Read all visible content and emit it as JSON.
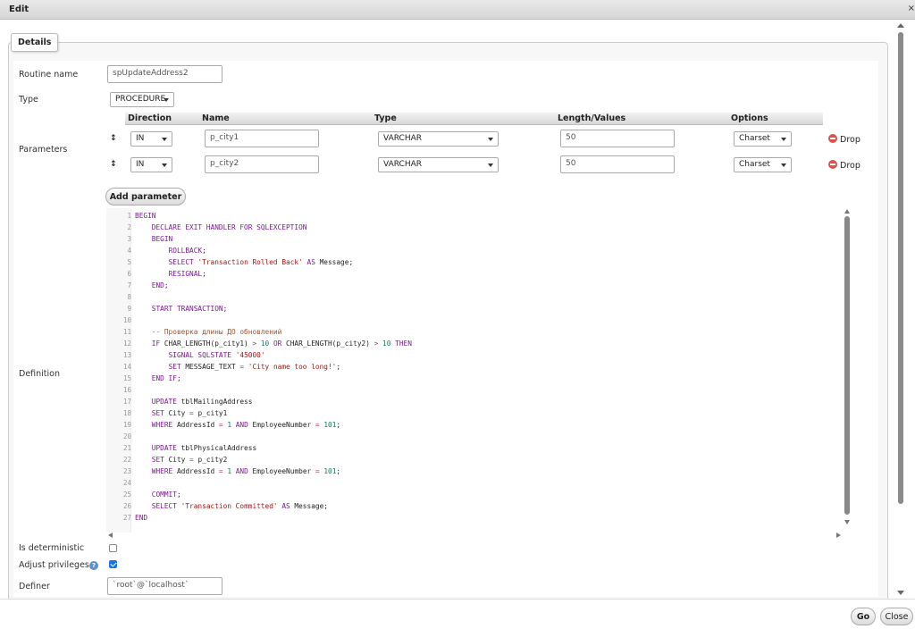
{
  "dialog": {
    "title": "Edit",
    "close_glyph": "×"
  },
  "tab": {
    "label": "Details"
  },
  "routine": {
    "label": "Routine name",
    "value": "spUpdateAddress2"
  },
  "type": {
    "label": "Type",
    "value": "PROCEDURE"
  },
  "parameters": {
    "label": "Parameters",
    "headers": {
      "direction": "Direction",
      "name": "Name",
      "type": "Type",
      "length": "Length/Values",
      "options": "Options"
    },
    "drag_glyph": "↕",
    "drop_label": "Drop",
    "rows": [
      {
        "direction": "IN",
        "name": "p_city1",
        "type": "VARCHAR",
        "length": "50",
        "options": "Charset"
      },
      {
        "direction": "IN",
        "name": "p_city2",
        "type": "VARCHAR",
        "length": "50",
        "options": "Charset"
      }
    ],
    "add_label": "Add parameter"
  },
  "definition": {
    "label": "Definition",
    "line_numbers": [
      "1",
      "2",
      "3",
      "4",
      "5",
      "6",
      "7",
      "8",
      "9",
      "10",
      "11",
      "12",
      "13",
      "14",
      "15",
      "16",
      "17",
      "18",
      "19",
      "20",
      "21",
      "22",
      "23",
      "24",
      "25",
      "26",
      "27"
    ]
  },
  "deterministic": {
    "label": "Is deterministic",
    "checked": false
  },
  "privileges": {
    "label": "Adjust privileges",
    "checked": true,
    "help_glyph": "?"
  },
  "definer": {
    "label": "Definer",
    "value": "`root`@`localhost`"
  },
  "footer": {
    "go_label": "Go",
    "close_label": "Close"
  },
  "colors": {
    "drop_icon": "#d9534f",
    "checkbox_checked": "#1a73e8",
    "help_icon": "#5b8fd6"
  }
}
